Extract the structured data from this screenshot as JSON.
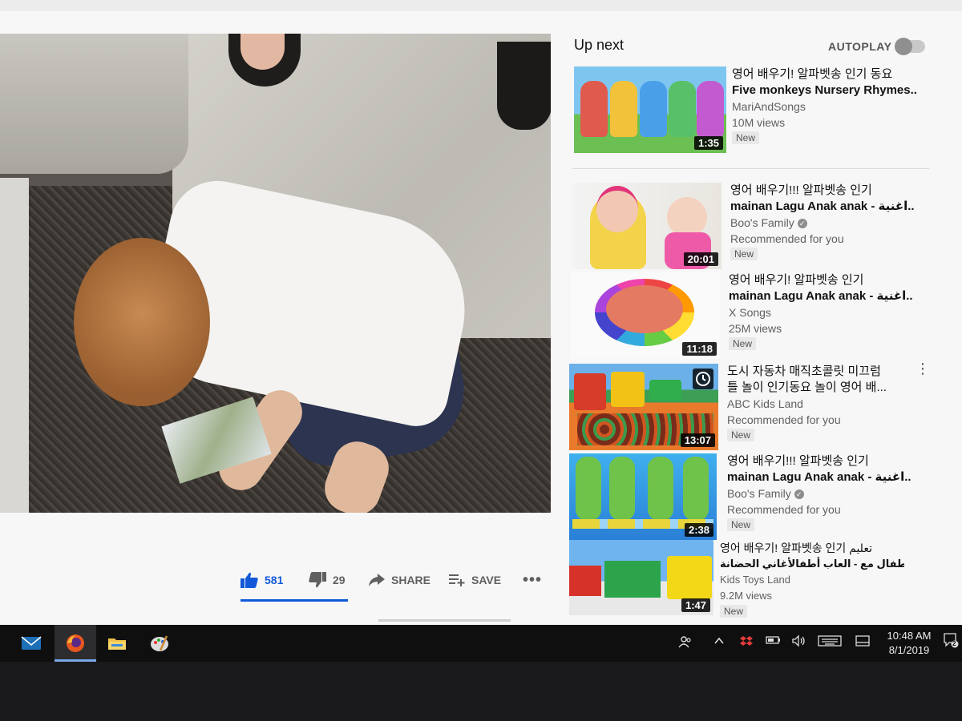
{
  "video": {
    "actions": {
      "like_count": "581",
      "dislike_count": "29",
      "share_label": "SHARE",
      "save_label": "SAVE",
      "more_label": "•••"
    }
  },
  "sidebar": {
    "up_next_label": "Up next",
    "autoplay_label": "AUTOPLAY",
    "autoplay_on": false,
    "items": [
      {
        "line1": "영어 배우기! 알파벳송 인기 동요",
        "line2": "Five monkeys Nursery Rhymes...",
        "channel": "MariAndSongs",
        "info": "10M views",
        "badge": "New",
        "duration": "1:35"
      },
      {
        "line1": "영어 배우기!!! 알파벳송 인기",
        "line2": "mainan Lagu Anak anak - اغنية...",
        "channel": "Boo's Family",
        "info": "Recommended for you",
        "badge": "New",
        "duration": "20:01"
      },
      {
        "line1": "영어 배우기! 알파벳송 인기",
        "line2": "mainan Lagu Anak anak - اغنية...",
        "channel": "X Songs",
        "info": "25M views",
        "badge": "New",
        "duration": "11:18"
      },
      {
        "line1": "도시 자동차 매직초콜릿 미끄럼",
        "line2": "틀 놀이 인기동요 놀이 영어 배...",
        "channel": "ABC Kids Land",
        "info": "Recommended for you",
        "badge": "New",
        "duration": "13:07"
      },
      {
        "line1": "영어 배우기!!! 알파벳송 인기",
        "line2": "mainan Lagu Anak anak - اغنية...",
        "channel": "Boo's Family",
        "info": "Recommended for you",
        "badge": "New",
        "duration": "2:38"
      },
      {
        "line1": "영어 배우기! 알파벳송 인기 تعليم",
        "line2": "الاطفال مع - العاب أطفالأغاني الحضانة...",
        "channel": "Kids Toys Land",
        "info": "9.2M views",
        "badge": "New",
        "duration": "1:47"
      }
    ]
  },
  "taskbar": {
    "time": "10:48 AM",
    "date": "8/1/2019",
    "notification_count": "2"
  },
  "colors": {
    "accent": "#1259d9",
    "taskbar": "#0f0f10"
  }
}
